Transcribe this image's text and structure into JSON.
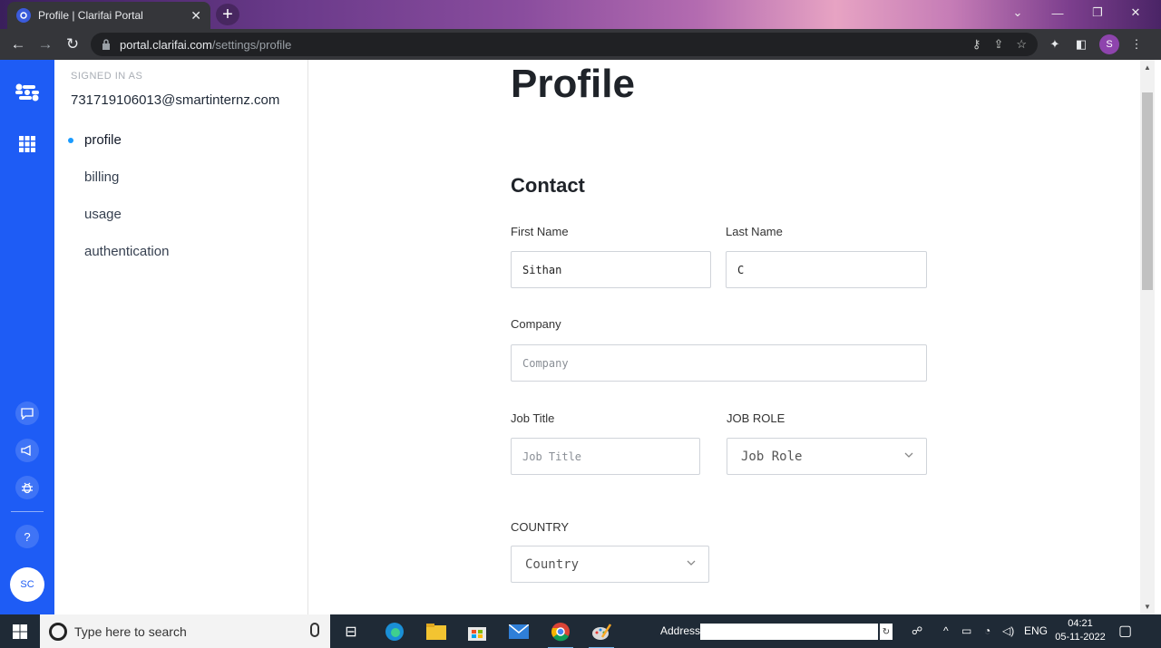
{
  "browser": {
    "tab_title": "Profile | Clarifai Portal",
    "tab_close": "✕",
    "new_tab": "+",
    "url_host": "portal.clarifai.com",
    "url_path": "/settings/profile",
    "profile_initial": "S"
  },
  "sidebar": {
    "signed_in_label": "SIGNED IN AS",
    "email": "731719106013@smartinternz.com",
    "items": [
      {
        "label": "profile",
        "active": true
      },
      {
        "label": "billing"
      },
      {
        "label": "usage"
      },
      {
        "label": "authentication"
      }
    ]
  },
  "rail": {
    "help": "?",
    "avatar": "SC"
  },
  "main": {
    "page_title": "Profile",
    "section_title": "Contact",
    "first_name_label": "First Name",
    "first_name_value": "Sithan",
    "last_name_label": "Last Name",
    "last_name_value": "C",
    "company_label": "Company",
    "company_placeholder": "Company",
    "job_title_label": "Job Title",
    "job_title_placeholder": "Job Title",
    "job_role_label": "JOB ROLE",
    "job_role_value": "Job Role",
    "country_label": "COUNTRY",
    "country_value": "Country"
  },
  "taskbar": {
    "search_placeholder": "Type here to search",
    "address_label": "Address",
    "language": "ENG",
    "time": "04:21",
    "date": "05-11-2022"
  },
  "colors": {
    "rail": "#1e5cf5",
    "active_dot": "#1a9bff"
  }
}
